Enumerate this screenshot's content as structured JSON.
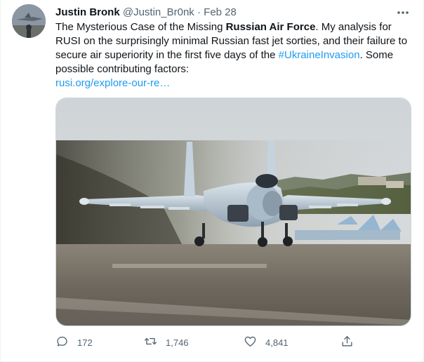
{
  "tweet": {
    "author_name": "Justin Bronk",
    "author_handle": "@Justin_Br0nk",
    "separator": "·",
    "date": "Feb 28",
    "text_1": "The Mysterious Case of the Missing ",
    "text_bold": "Russian Air Force",
    "text_2": ". My analysis for RUSI on the surprisingly minimal Russian fast jet sorties, and their failure to secure air superiority in the first five days of the ",
    "hashtag": "#UkraineInvasion",
    "text_3": ". Some possible contributing factors:",
    "url": "rusi.org/explore-our-re…"
  },
  "actions": {
    "reply_count": "172",
    "retweet_count": "1,746",
    "like_count": "4,841"
  },
  "icons": {
    "more": "more-horizontal-icon",
    "reply": "reply-icon",
    "retweet": "retweet-icon",
    "like": "heart-icon",
    "share": "share-icon"
  },
  "colors": {
    "link": "#1d9bf0",
    "secondary_text": "#536471",
    "primary_text": "#0f1419"
  }
}
